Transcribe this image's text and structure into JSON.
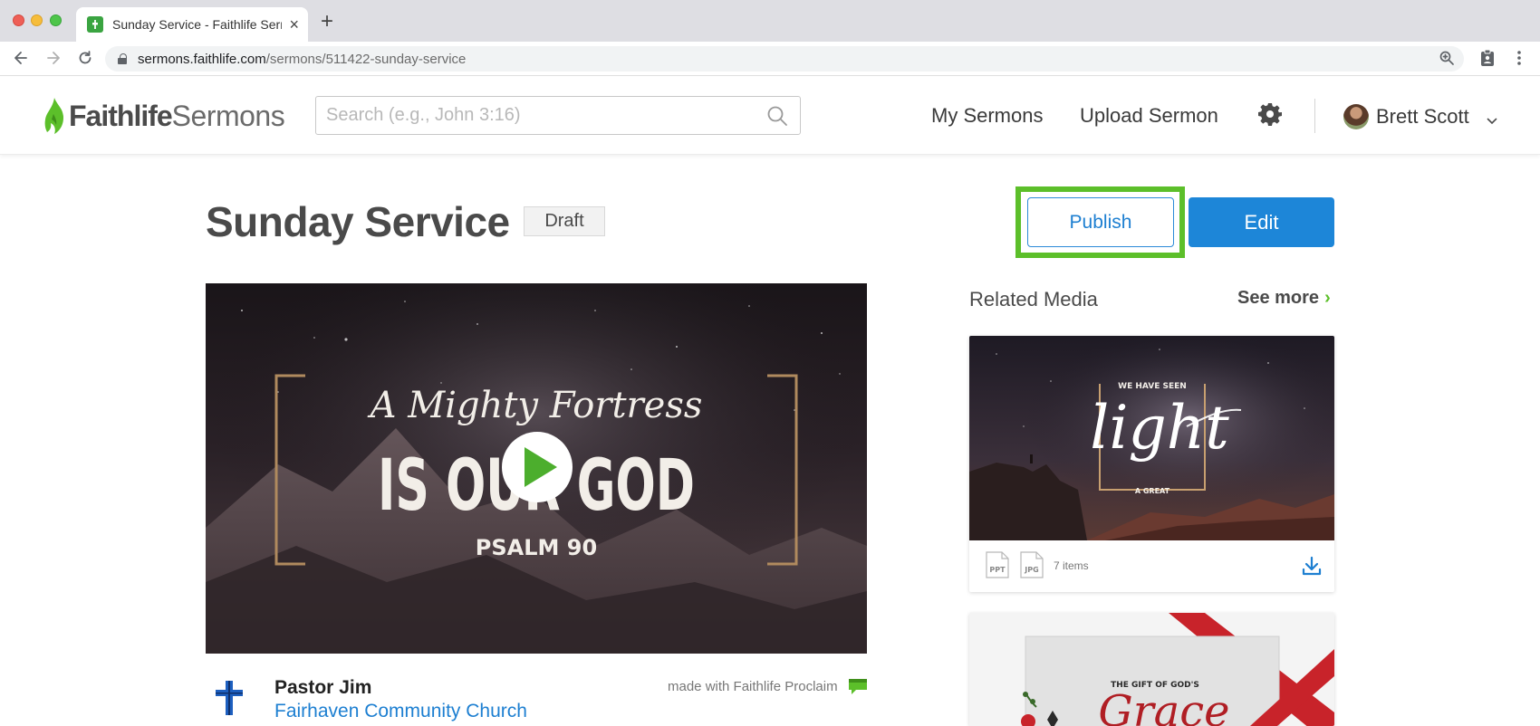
{
  "browser": {
    "tab_title": "Sunday Service - Faithlife Sermons",
    "url_host": "sermons.faithlife.com",
    "url_path": "/sermons/511422-sunday-service"
  },
  "header": {
    "logo_bold": "Faithlife",
    "logo_light": "Sermons",
    "search_placeholder": "Search (e.g., John 3:16)",
    "nav": {
      "my_sermons": "My Sermons",
      "upload_sermon": "Upload Sermon"
    },
    "user_name": "Brett Scott"
  },
  "sermon": {
    "title": "Sunday Service",
    "status": "Draft",
    "publish_label": "Publish",
    "edit_label": "Edit",
    "video": {
      "line1": "A Mighty Fortress",
      "line2": "IS OUR GOD",
      "line3": "PSALM 90"
    },
    "pastor": "Pastor Jim",
    "church": "Fairhaven Community Church",
    "made_with": "made with Faithlife Proclaim"
  },
  "related": {
    "title": "Related Media",
    "see_more": "See more",
    "cards": [
      {
        "art_top": "WE HAVE SEEN",
        "art_main": "light",
        "art_bottom": "A GREAT",
        "file_types": [
          "PPT",
          "JPG"
        ],
        "item_count": "7 items"
      },
      {
        "art_top": "THE GIFT OF GOD'S",
        "art_main": "Grace"
      }
    ]
  },
  "colors": {
    "accent_green": "#5cbf2a",
    "link_blue": "#1d7fd1",
    "edit_blue": "#1d86d8"
  }
}
